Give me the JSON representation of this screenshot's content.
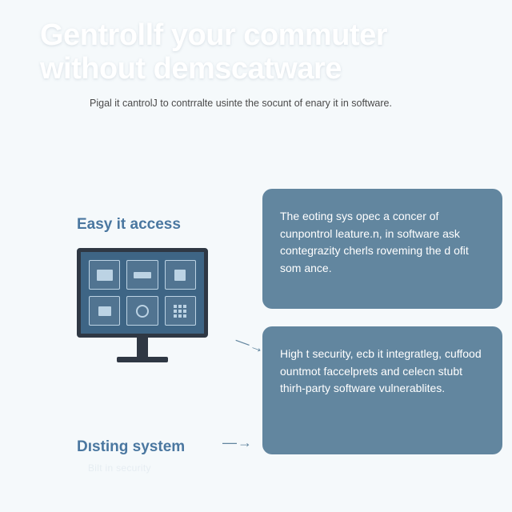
{
  "hero": {
    "title_line1": "Gentrollf your commuter",
    "title_line2": "without demscatware",
    "subtitle": "Pigal it cantrolJ to contrralte usinte the socunt of enary it in software."
  },
  "sections": {
    "easy_access": {
      "heading": "Easy it access"
    },
    "disting_system": {
      "heading": "Dısting system",
      "ghost": "Bilt in security"
    }
  },
  "cards": {
    "card1": "The eoting sys opec a concer of cunpontrol leature.n, in software ask contegrazity cherls roveming the d ofit som ance.",
    "card2": "High t security, ecb it integratleg, cuffood ountmot faccelprets and celecn stubt thirh-party software vulnerablites."
  },
  "arrows": {
    "a1": "— →",
    "a2": "— →"
  }
}
